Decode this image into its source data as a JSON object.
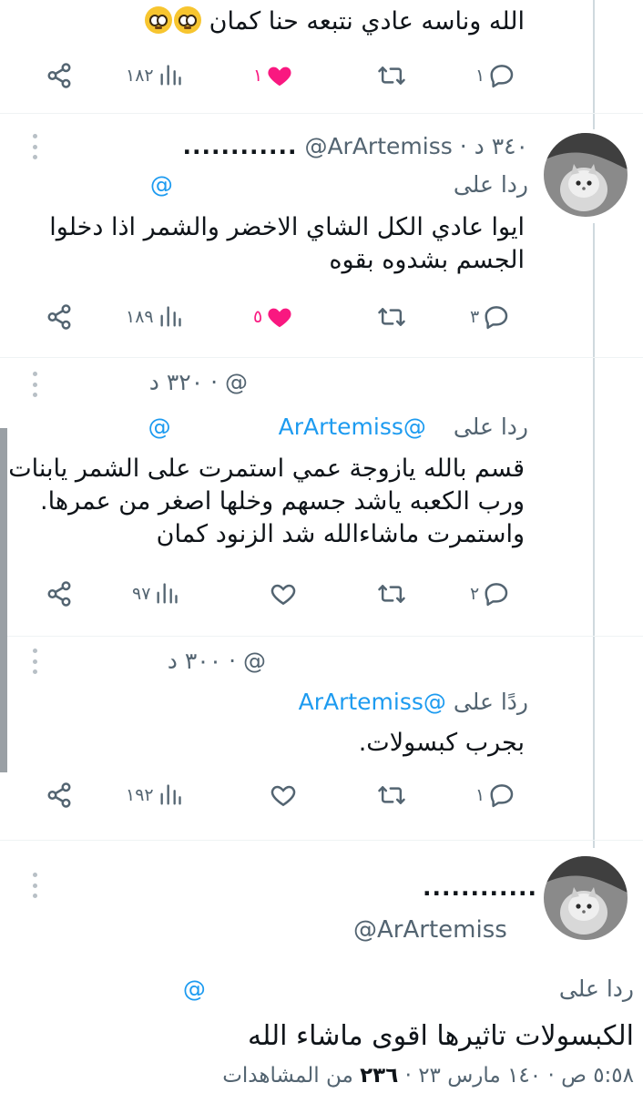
{
  "thread": [
    {
      "text_lines": [
        "الله وناسه عادي نتبعه حنا كمان"
      ],
      "emoji_count": 2,
      "actions": {
        "replies": "١",
        "retweets": "",
        "likes": "١",
        "liked": true,
        "views": "١٨٢"
      }
    },
    {
      "display_name": "............",
      "handle": "@ArArtemiss",
      "time": "٣٤٠ د",
      "reply_prefix": "ردا على",
      "reply_to": "@",
      "text_lines": [
        "ايوا عادي الكل الشاي الاخضر والشمر اذا دخلوا",
        "الجسم بشدوه بقوه"
      ],
      "actions": {
        "replies": "٣",
        "likes": "٥",
        "liked": true,
        "views": "١٨٩"
      }
    },
    {
      "handle": "@",
      "time": "٣٢٠ د",
      "reply_prefix": "ردا على",
      "reply_to_a": "@ArArtemiss",
      "reply_to_b": "@",
      "text_lines": [
        "قسم بالله يازوجة عمي استمرت على الشمر يابنات",
        "ورب الكعبه ياشد جسهم وخلها اصغر من عمرها.",
        "واستمرت ماشاءالله شد الزنود كمان"
      ],
      "actions": {
        "replies": "٢",
        "likes": "",
        "liked": false,
        "views": "٩٧"
      }
    },
    {
      "handle": "@",
      "time": "٣٠٠ د",
      "reply_prefix": "ردًا على",
      "reply_to": "@ArArtemiss",
      "text_lines": [
        "بجرب كبسولات."
      ],
      "actions": {
        "replies": "١",
        "likes": "",
        "liked": false,
        "views": "١٩٢"
      }
    },
    {
      "display_name": "............",
      "handle": "@ArArtemiss",
      "reply_prefix": "ردا على",
      "reply_to": "@",
      "text_lines": [
        "الكبسولات تاثيرها اقوى ماشاء الله"
      ],
      "footer": {
        "time": "٥:٥٨ ص",
        "date": "١٤٠ مارس ٢٣",
        "views_count": "٢٣٦",
        "views_label": "من المشاهدات"
      }
    }
  ],
  "colors": {
    "text": "#0f1419",
    "secondary": "#536471",
    "link": "#1d9bf0",
    "like": "#f91880",
    "thread_line": "#cfd9de"
  },
  "icons": [
    "reply-icon",
    "retweet-icon",
    "like-icon",
    "views-icon",
    "share-icon",
    "more-icon",
    "pleading-face-emoji"
  ]
}
